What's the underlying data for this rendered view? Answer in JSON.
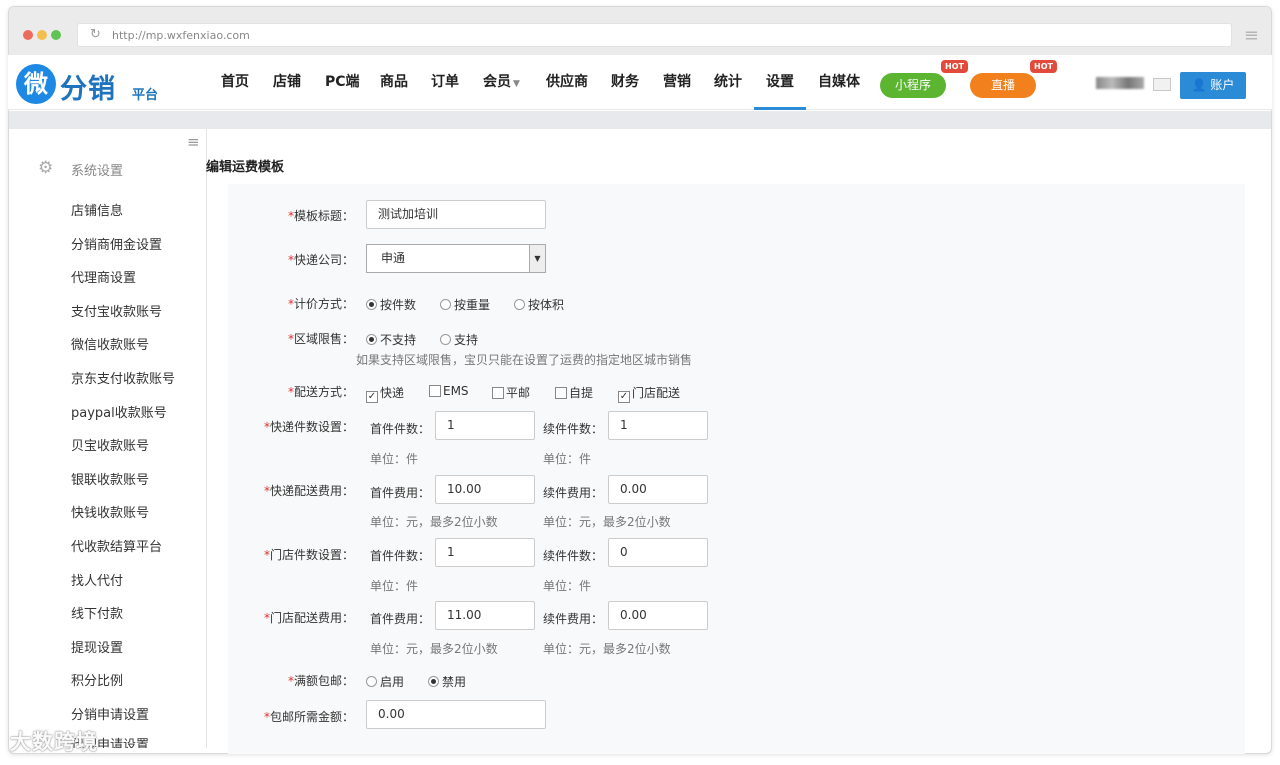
{
  "browser": {
    "url": "http://mp.wxfenxiao.com"
  },
  "brand": {
    "logo_char": "微",
    "name": "分销",
    "sub": "平台"
  },
  "nav": {
    "items": [
      {
        "label": "首页"
      },
      {
        "label": "店铺"
      },
      {
        "label": "PC端"
      },
      {
        "label": "商品"
      },
      {
        "label": "订单"
      },
      {
        "label": "会员"
      },
      {
        "label": "供应商"
      },
      {
        "label": "财务"
      },
      {
        "label": "营销"
      },
      {
        "label": "统计"
      },
      {
        "label": "设置"
      },
      {
        "label": "自媒体"
      }
    ],
    "active": "设置",
    "mini_program": "小程序",
    "live": "直播",
    "hot_badge": "HOT",
    "account": "账户"
  },
  "sidebar": {
    "section": "系统设置",
    "items": [
      "店铺信息",
      "分销商佣金设置",
      "代理商设置",
      "支付宝收款账号",
      "微信收款账号",
      "京东支付收款账号",
      "paypal收款账号",
      "贝宝收款账号",
      "银联收款账号",
      "快钱收款账号",
      "代收款结算平台",
      "找人代付",
      "线下付款",
      "提现设置",
      "积分比例",
      "分销申请设置",
      "代理申请设置"
    ]
  },
  "page": {
    "title": "编辑运费模板"
  },
  "form": {
    "template_title": {
      "label": "模板标题：",
      "value": "测试加培训"
    },
    "courier": {
      "label": "快递公司：",
      "value": "申通"
    },
    "pricing": {
      "label": "计价方式：",
      "options": [
        "按件数",
        "按重量",
        "按体积"
      ],
      "selected": "按件数"
    },
    "region": {
      "label": "区域限售：",
      "options": [
        "不支持",
        "支持"
      ],
      "selected": "不支持",
      "hint": "如果支持区域限售，宝贝只能在设置了运费的指定地区城市销售"
    },
    "delivery": {
      "label": "配送方式：",
      "options": [
        "快递",
        "EMS",
        "平邮",
        "自提",
        "门店配送"
      ],
      "checked": [
        "快递",
        "门店配送"
      ]
    },
    "express_count": {
      "label": "快递件数设置：",
      "first_label": "首件件数：",
      "first": "1",
      "next_label": "续件件数：",
      "next": "1",
      "unit": "单位：件"
    },
    "express_fee": {
      "label": "快递配送费用：",
      "first_label": "首件费用：",
      "first": "10.00",
      "next_label": "续件费用：",
      "next": "0.00",
      "unit": "单位：元，最多2位小数"
    },
    "store_count": {
      "label": "门店件数设置：",
      "first_label": "首件件数：",
      "first": "1",
      "next_label": "续件件数：",
      "next": "0",
      "unit": "单位：件"
    },
    "store_fee": {
      "label": "门店配送费用：",
      "first_label": "首件费用：",
      "first": "11.00",
      "next_label": "续件费用：",
      "next": "0.00",
      "unit": "单位：元，最多2位小数"
    },
    "free_shipping": {
      "label": "满额包邮：",
      "options": [
        "启用",
        "禁用"
      ],
      "selected": "禁用"
    },
    "free_amount": {
      "label": "包邮所需金额：",
      "value": "0.00"
    }
  },
  "watermark": "大数跨境"
}
